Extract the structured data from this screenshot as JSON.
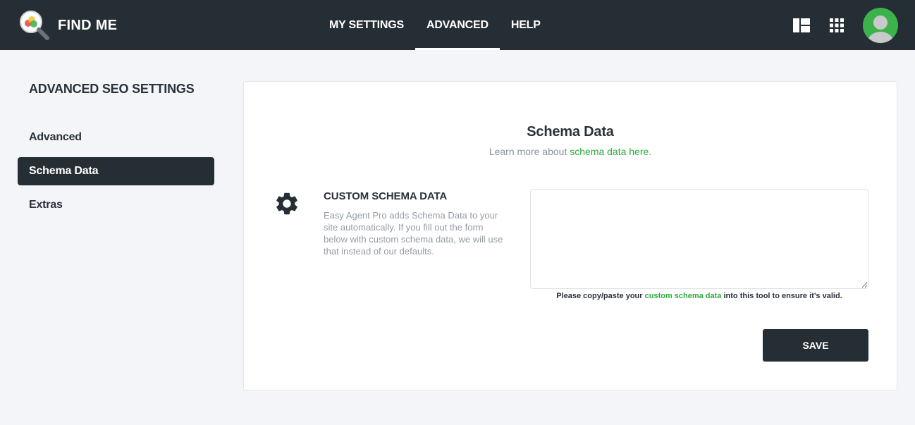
{
  "header": {
    "brand_title": "FIND ME",
    "nav": [
      {
        "label": "MY SETTINGS",
        "active": false
      },
      {
        "label": "ADVANCED",
        "active": true
      },
      {
        "label": "HELP",
        "active": false
      }
    ],
    "icons": [
      "layout-icon",
      "apps-grid-icon",
      "avatar"
    ]
  },
  "sidebar": {
    "title": "ADVANCED SEO SETTINGS",
    "items": [
      {
        "label": "Advanced",
        "active": false
      },
      {
        "label": "Schema Data",
        "active": true
      },
      {
        "label": "Extras",
        "active": false
      }
    ]
  },
  "card": {
    "title": "Schema Data",
    "subtitle_prefix": "Learn more about ",
    "subtitle_link": "schema data here",
    "subtitle_suffix": ".",
    "section_title": "CUSTOM SCHEMA DATA",
    "section_description": "Easy Agent Pro adds Schema Data to your site automatically. If you fill out the form below with custom schema data, we will use that instead of our defaults.",
    "textarea_value": "",
    "help_prefix": "Please copy/paste your ",
    "help_link": "custom schema data",
    "help_suffix": " into this tool to ensure it's valid.",
    "save_label": "SAVE"
  },
  "colors": {
    "dark": "#262e35",
    "accent_green": "#2eab3f",
    "background": "#f4f5f9"
  }
}
